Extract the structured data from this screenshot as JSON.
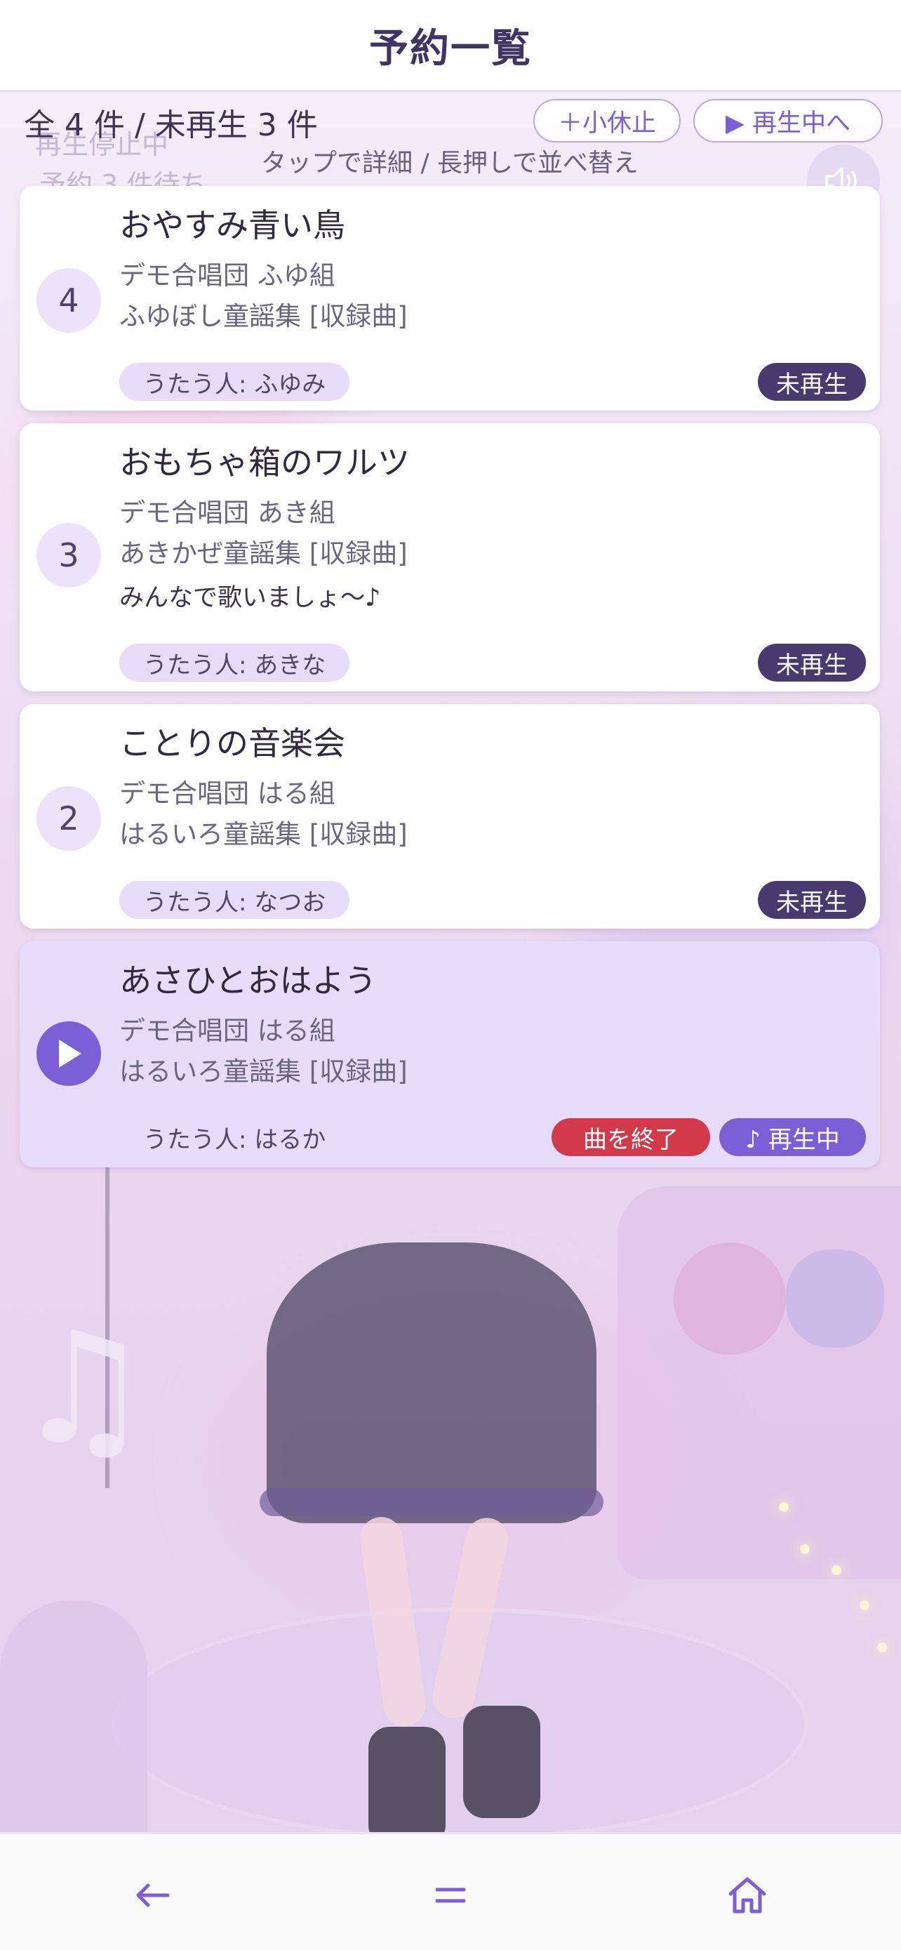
{
  "header": {
    "title": "予約一覧"
  },
  "summary": {
    "counts": "全 4 件 / 未再生 3 件",
    "hint": "タップで詳細 / 長押しで並べ替え",
    "bg_status": "再生停止中",
    "bg_queue": "予約 3 件待ち",
    "break_button": "＋小休止",
    "playing_button": "▶ 再生中へ"
  },
  "colors": {
    "accent": "#7a5fd6",
    "title": "#3e3565",
    "status_dark": "#463a6e",
    "end_red": "#d23a4a",
    "playing_card": "#e7dcfa"
  },
  "queue": [
    {
      "number": "4",
      "title": "おやすみ青い鳥",
      "group": "デモ合唱団 ふゆ組",
      "album": "ふゆぼし童謡集 [収録曲]",
      "comment": "",
      "singer": "うたう人: ふゆみ",
      "status": "未再生"
    },
    {
      "number": "3",
      "title": "おもちゃ箱のワルツ",
      "group": "デモ合唱団 あき組",
      "album": "あきかぜ童謡集 [収録曲]",
      "comment": "みんなで歌いましょ〜♪",
      "singer": "うたう人: あきな",
      "status": "未再生"
    },
    {
      "number": "2",
      "title": "ことりの音楽会",
      "group": "デモ合唱団 はる組",
      "album": "はるいろ童謡集 [収録曲]",
      "comment": "",
      "singer": "うたう人: なつお",
      "status": "未再生"
    },
    {
      "number": "",
      "title": "あさひとおはよう",
      "group": "デモ合唱団 はる組",
      "album": "はるいろ童謡集 [収録曲]",
      "comment": "",
      "singer": "うたう人: はるか",
      "end_label": "曲を終了",
      "status": "♪ 再生中"
    }
  ],
  "icons": {
    "play": "play-icon",
    "volume": "volume-icon",
    "back": "arrow-left-icon",
    "menu": "menu-icon",
    "home": "home-icon"
  }
}
